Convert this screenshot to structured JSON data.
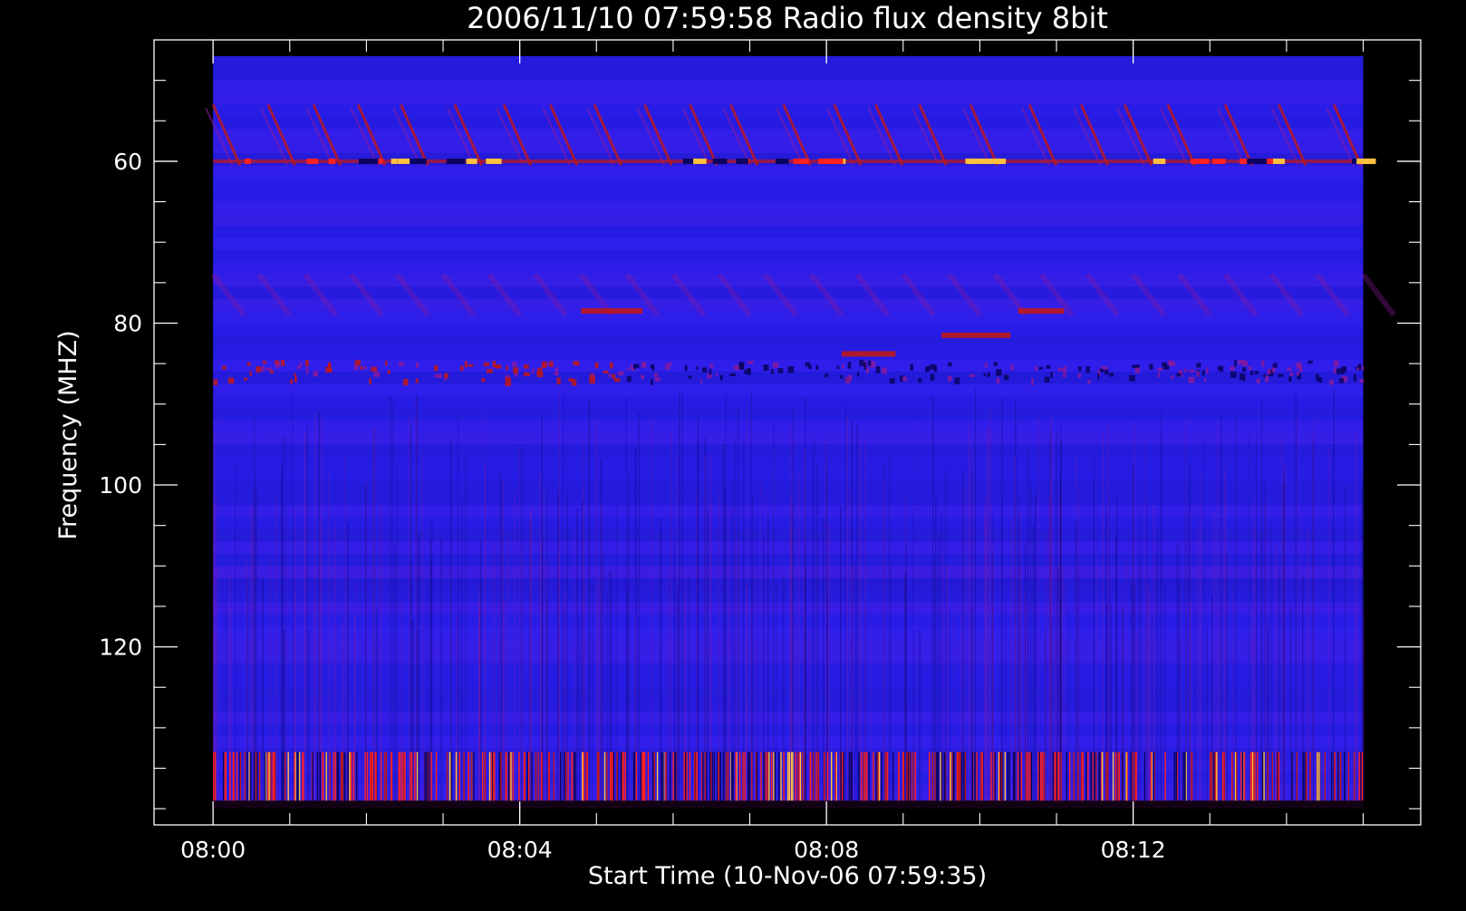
{
  "chart_data": {
    "type": "heatmap",
    "title": "2006/11/10 07:59:58 Radio flux density 8bit",
    "xlabel": "Start Time (10-Nov-06 07:59:35)",
    "ylabel": "Frequency (MHZ)",
    "x_ticks": [
      "08:00",
      "08:04",
      "08:08",
      "08:12"
    ],
    "x_tick_minutes": [
      0,
      4,
      8,
      12
    ],
    "y_ticks": [
      60,
      80,
      100,
      120
    ],
    "xlim_minutes": [
      -0.77,
      15.75
    ],
    "ylim_mhz": [
      45,
      142
    ],
    "data_x_range_minutes": [
      0,
      15
    ],
    "data_y_range_mhz": [
      47,
      139
    ],
    "colors": {
      "background": "#000000",
      "axis": "#ffffff",
      "base": "#2a1ff0",
      "dark": "#0a0460",
      "red": "#c01818",
      "purple": "#8a1a9a",
      "yellow": "#ffc040",
      "bright_red": "#ff2020"
    },
    "features": [
      {
        "kind": "drifting bursts",
        "freq_mhz": [
          53,
          61
        ],
        "intensity": "high"
      },
      {
        "kind": "persistent line",
        "freq_mhz": 60,
        "intensity": "red/yellow"
      },
      {
        "kind": "dark/red band",
        "freq_mhz": 86,
        "intensity": "mixed"
      },
      {
        "kind": "broadband bursts",
        "freq_mhz": [
          133,
          139
        ],
        "intensity": "yellow/red"
      }
    ]
  }
}
